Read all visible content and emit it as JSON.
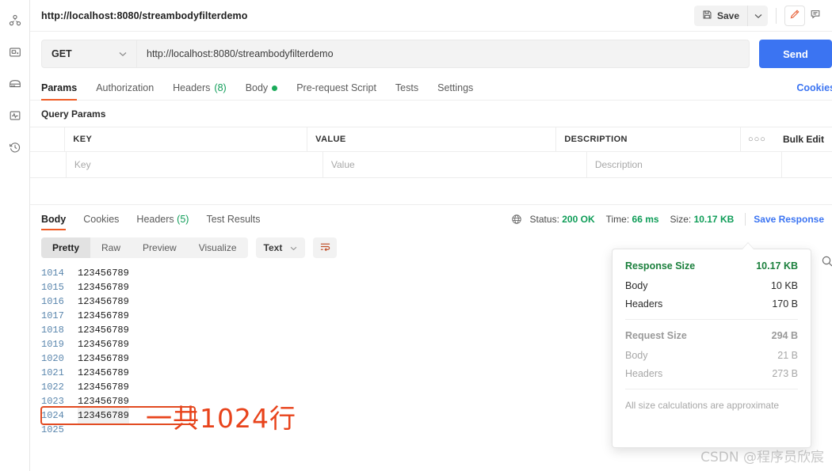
{
  "sidebar": {
    "items": [
      {
        "name": "collections-icon",
        "label": "Collections"
      },
      {
        "name": "apis-icon",
        "label": "APIs"
      },
      {
        "name": "environments-icon",
        "label": "Environments"
      },
      {
        "name": "monitors-icon",
        "label": "Monitors"
      },
      {
        "name": "history-icon",
        "label": "History"
      }
    ]
  },
  "titlebar": {
    "request_title": "http://localhost:8080/streambodyfilterdemo",
    "save_label": "Save",
    "save_caret": "⌄",
    "edit_icon": "pencil-icon",
    "comment_icon": "comment-icon"
  },
  "request": {
    "method": "GET",
    "method_caret": "⌄",
    "url": "http://localhost:8080/streambodyfilterdemo",
    "send_label": "Send",
    "tabs": [
      {
        "label": "Params",
        "count": "",
        "active": true,
        "dot": false
      },
      {
        "label": "Authorization",
        "count": "",
        "active": false,
        "dot": false
      },
      {
        "label": "Headers",
        "count": "(8)",
        "active": false,
        "dot": false
      },
      {
        "label": "Body",
        "count": "",
        "active": false,
        "dot": true
      },
      {
        "label": "Pre-request Script",
        "count": "",
        "active": false,
        "dot": false
      },
      {
        "label": "Tests",
        "count": "",
        "active": false,
        "dot": false
      },
      {
        "label": "Settings",
        "count": "",
        "active": false,
        "dot": false
      }
    ],
    "cookies_link": "Cookies"
  },
  "query_params": {
    "section_label": "Query Params",
    "columns": [
      "KEY",
      "VALUE",
      "DESCRIPTION"
    ],
    "dots_label": "○○○",
    "bulk_edit_label": "Bulk Edit",
    "rows": [
      {
        "key": "Key",
        "value": "Value",
        "description": "Description"
      }
    ]
  },
  "response": {
    "tabs": [
      {
        "label": "Body",
        "count": "",
        "active": true
      },
      {
        "label": "Cookies",
        "count": "",
        "active": false
      },
      {
        "label": "Headers",
        "count": "(5)",
        "active": false
      },
      {
        "label": "Test Results",
        "count": "",
        "active": false
      }
    ],
    "status_label": "Status:",
    "status_value": "200 OK",
    "time_label": "Time:",
    "time_value": "66 ms",
    "size_label": "Size:",
    "size_value": "10.17 KB",
    "save_response_label": "Save Response",
    "view_modes": [
      {
        "label": "Pretty",
        "active": true
      },
      {
        "label": "Raw",
        "active": false
      },
      {
        "label": "Preview",
        "active": false
      },
      {
        "label": "Visualize",
        "active": false
      }
    ],
    "format": "Text",
    "format_caret": "⌄",
    "wrap_icon": "word-wrap-icon",
    "search_icon": "search-icon"
  },
  "code": {
    "lines": [
      {
        "num": "1014",
        "text": "123456789",
        "highlight": false
      },
      {
        "num": "1015",
        "text": "123456789",
        "highlight": false
      },
      {
        "num": "1016",
        "text": "123456789",
        "highlight": false
      },
      {
        "num": "1017",
        "text": "123456789",
        "highlight": false
      },
      {
        "num": "1018",
        "text": "123456789",
        "highlight": false
      },
      {
        "num": "1019",
        "text": "123456789",
        "highlight": false
      },
      {
        "num": "1020",
        "text": "123456789",
        "highlight": false
      },
      {
        "num": "1021",
        "text": "123456789",
        "highlight": false
      },
      {
        "num": "1022",
        "text": "123456789",
        "highlight": false
      },
      {
        "num": "1023",
        "text": "123456789",
        "highlight": false
      },
      {
        "num": "1024",
        "text": "123456789",
        "highlight": true
      },
      {
        "num": "1025",
        "text": "",
        "highlight": false
      }
    ]
  },
  "popover": {
    "response_size_label": "Response Size",
    "response_size_value": "10.17 KB",
    "response_body_label": "Body",
    "response_body_value": "10 KB",
    "response_headers_label": "Headers",
    "response_headers_value": "170 B",
    "request_size_label": "Request Size",
    "request_size_value": "294 B",
    "request_body_label": "Body",
    "request_body_value": "21 B",
    "request_headers_label": "Headers",
    "request_headers_value": "273 B",
    "note": "All size calculations are approximate"
  },
  "annotation": {
    "text": "一共1024行"
  },
  "watermark": {
    "text": "CSDN @程序员欣宸"
  },
  "colors": {
    "accent_orange": "#ef5b25",
    "send_blue": "#3b74f2",
    "status_green": "#0f9d58",
    "annotation_red": "#e8431b"
  }
}
